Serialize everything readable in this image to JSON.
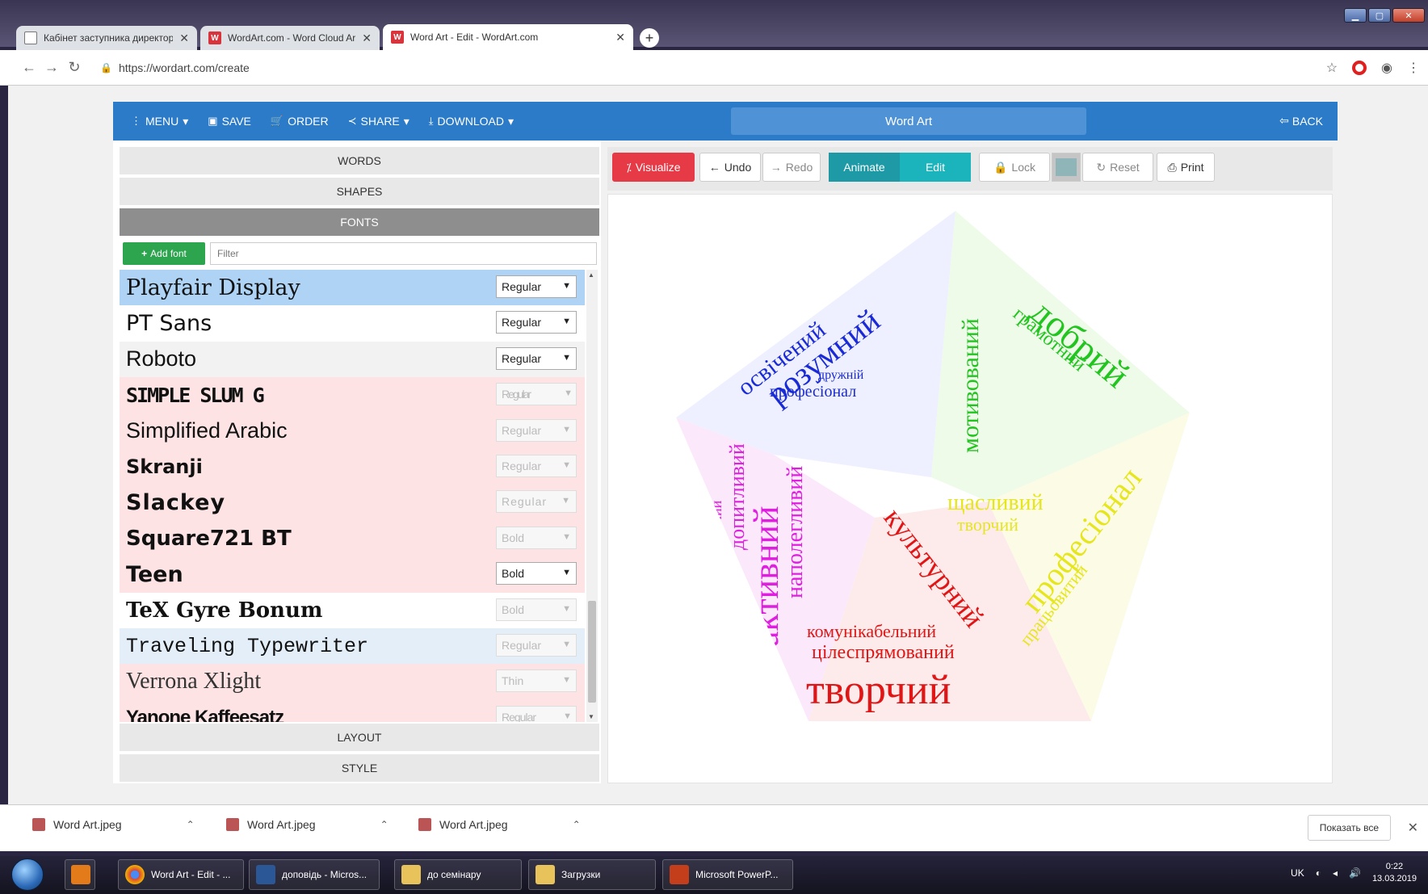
{
  "browser": {
    "tabs": [
      {
        "title": "Кабінет заступника директора з",
        "icon": "doc-icon"
      },
      {
        "title": "WordArt.com - Word Cloud Art C",
        "icon": "wordart-icon"
      },
      {
        "title": "Word Art - Edit - WordArt.com",
        "icon": "wordart-icon"
      }
    ],
    "url": "https://wordart.com/create"
  },
  "app": {
    "menu": [
      "MENU",
      "SAVE",
      "ORDER",
      "SHARE",
      "DOWNLOAD"
    ],
    "title": "Word Art",
    "back": "BACK"
  },
  "left_panel": {
    "sections": [
      "WORDS",
      "SHAPES",
      "FONTS",
      "LAYOUT",
      "STYLE"
    ],
    "add_font": "Add font",
    "filter_placeholder": "Filter",
    "fonts": [
      {
        "name": "Playfair Display",
        "style": "Regular",
        "enabled": true,
        "bg": "#aed3f5"
      },
      {
        "name": "PT Sans",
        "style": "Regular",
        "enabled": true,
        "bg": "#ffffff"
      },
      {
        "name": "Roboto",
        "style": "Regular",
        "enabled": true,
        "bg": "#f2f2f2"
      },
      {
        "name": "SIMPLE SLUM G",
        "style": "Regular",
        "enabled": false,
        "bg": "#fde3e3"
      },
      {
        "name": "Simplified Arabic",
        "style": "Regular",
        "enabled": false,
        "bg": "#fde3e3"
      },
      {
        "name": "Skranji",
        "style": "Regular",
        "enabled": false,
        "bg": "#fde3e3"
      },
      {
        "name": "Slackey",
        "style": "Regular",
        "enabled": false,
        "bg": "#fde3e3"
      },
      {
        "name": "Square721 BT",
        "style": "Bold",
        "enabled": false,
        "bg": "#fde3e3"
      },
      {
        "name": "Teen",
        "style": "Bold",
        "enabled": true,
        "bg": "#fde3e3"
      },
      {
        "name": "TeX Gyre Bonum",
        "style": "Bold",
        "enabled": false,
        "bg": "#ffffff"
      },
      {
        "name": "Traveling Typewriter",
        "style": "Regular",
        "enabled": false,
        "bg": "#e3eef9"
      },
      {
        "name": "Verrona Xlight",
        "style": "Thin",
        "enabled": false,
        "bg": "#fde3e3"
      },
      {
        "name": "Yanone Kaffeesatz",
        "style": "Regular",
        "enabled": false,
        "bg": "#fde3e3"
      }
    ]
  },
  "toolbar": {
    "visualize": "Visualize",
    "undo": "Undo",
    "redo": "Redo",
    "animate": "Animate",
    "edit": "Edit",
    "lock": "Lock",
    "reset": "Reset",
    "print": "Print",
    "swatch_color": "#8fb5b8"
  },
  "wordcloud": {
    "regions": [
      {
        "color": "#1a2bd6",
        "words": [
          "розумний",
          "освічений",
          "дружній",
          "професіонал"
        ]
      },
      {
        "color": "#22c41f",
        "words": [
          "добрий",
          "мотивований",
          "грамотний",
          "активний"
        ]
      },
      {
        "color": "#e6e61f",
        "words": [
          "професіонал",
          "щасливий",
          "працьовитий",
          "творчий"
        ]
      },
      {
        "color": "#e01515",
        "words": [
          "творчий",
          "культурний",
          "цілеспрямований",
          "комунікабельний"
        ]
      },
      {
        "color": "#e01ee0",
        "words": [
          "активний",
          "наполегливий",
          "допитливий",
          "грамотний"
        ]
      }
    ]
  },
  "downloads": {
    "files": [
      "Word Art.jpeg",
      "Word Art.jpeg",
      "Word Art.jpeg"
    ],
    "show_all": "Показать все"
  },
  "taskbar": {
    "items": [
      "Word Art - Edit - ...",
      "доповідь - Micros...",
      "до семінару",
      "Загрузки",
      "Microsoft PowerP..."
    ],
    "lang": "UK",
    "time": "0:22",
    "date": "13.03.2019"
  }
}
